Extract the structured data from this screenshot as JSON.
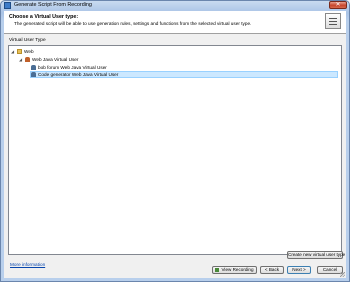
{
  "window": {
    "title": "Generate Script From Recording",
    "close_label": "✕"
  },
  "header": {
    "title": "Choose a Virtual User type:",
    "description": "The generated script will be able to use generation rules, settings and functions from the selected virtual user type."
  },
  "group": {
    "label": "Virtual User Type"
  },
  "tree": {
    "items": [
      {
        "label": "Web",
        "expanded": true,
        "icon": "folder-icon"
      },
      {
        "label": "Web Java Virtual User",
        "expanded": true,
        "icon": "user-icon"
      },
      {
        "label": "bob forum Web Java Virtual User",
        "icon": "user-icon"
      },
      {
        "label": "Code generator Web Java Virtual User",
        "icon": "user-icon",
        "selected": true
      }
    ]
  },
  "footer": {
    "more_info": "More information",
    "create_button": "Create new virtual user type",
    "view_recording": "View Recording",
    "back": "< Back",
    "next": "Next >",
    "cancel": "Cancel"
  },
  "colors": {
    "selection": "#cce8ff",
    "link": "#0645ad",
    "titlebar": "#b8cfec"
  }
}
